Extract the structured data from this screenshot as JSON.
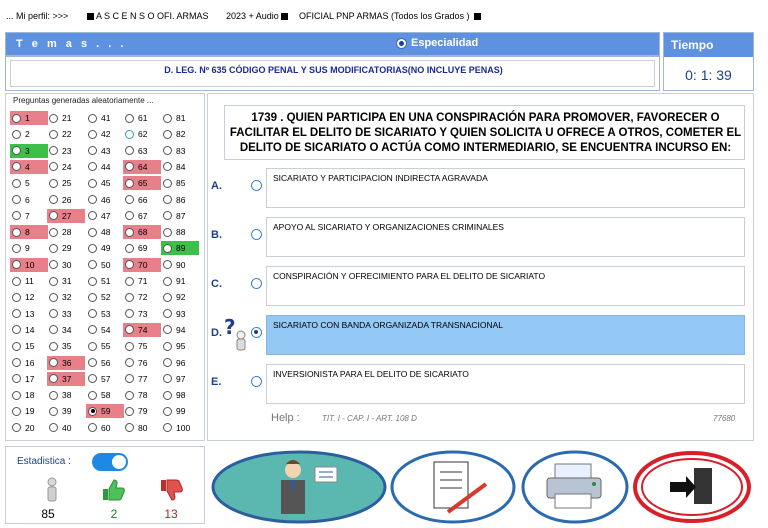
{
  "topbar": {
    "perfil": "... Mi perfil:  >>>",
    "censo": "A S C E N S O  OFI. ARMAS",
    "year": "2023  +  Audio",
    "oficial": "OFICIAL  PNP  ARMAS  (Todos los Grados )"
  },
  "header": {
    "temas": "T e m a s . . .",
    "especialidad": "Especialidad",
    "tema_text": "D. LEG. Nº 635 CÓDIGO PENAL Y SUS MODIFICATORIAS(NO INCLUYE PENAS)"
  },
  "tiempo": {
    "title": "Tiempo",
    "value": "0: 1: 39"
  },
  "grid": {
    "title": "Preguntas generadas aleatoriamente ...",
    "columns": [
      [
        "1",
        "2",
        "3",
        "4",
        "5",
        "6",
        "7",
        "8",
        "9",
        "10",
        "11",
        "12",
        "13",
        "14",
        "15",
        "16",
        "17",
        "18",
        "19",
        "20"
      ],
      [
        "21",
        "22",
        "23",
        "24",
        "25",
        "26",
        "27",
        "28",
        "29",
        "30",
        "31",
        "32",
        "33",
        "34",
        "35",
        "36",
        "37",
        "38",
        "39",
        "40"
      ],
      [
        "41",
        "42",
        "43",
        "44",
        "45",
        "46",
        "47",
        "48",
        "49",
        "50",
        "51",
        "52",
        "53",
        "54",
        "55",
        "56",
        "57",
        "58",
        "59",
        "60"
      ],
      [
        "61",
        "62",
        "63",
        "64",
        "65",
        "66",
        "67",
        "68",
        "69",
        "70",
        "71",
        "72",
        "73",
        "74",
        "75",
        "76",
        "77",
        "78",
        "79",
        "80"
      ],
      [
        "81",
        "82",
        "83",
        "84",
        "85",
        "86",
        "87",
        "88",
        "89",
        "90",
        "91",
        "92",
        "93",
        "94",
        "95",
        "96",
        "97",
        "98",
        "99",
        "100"
      ]
    ],
    "red": [
      "1",
      "4",
      "8",
      "10",
      "27",
      "36",
      "37",
      "59",
      "64",
      "65",
      "68",
      "70",
      "74"
    ],
    "green": [
      "3",
      "89"
    ],
    "cyan": [
      "62"
    ],
    "selected": [
      "59"
    ]
  },
  "question": {
    "text": "1739 . QUIEN PARTICIPA EN UNA CONSPIRACIÓN PARA PROMOVER, FAVORECER O FACILITAR EL DELITO DE SICARIATO Y QUIEN SOLICITA U OFRECE A OTROS, COMETER EL DELITO DE SICARIATO O ACTÚA COMO INTERMEDIARIO, SE ENCUENTRA INCURSO EN:",
    "options": [
      {
        "letter": "A.",
        "text": "SICARIATO Y PARTICIPACION INDIRECTA AGRAVADA"
      },
      {
        "letter": "B.",
        "text": "APOYO AL SICARIATO Y ORGANIZACIONES CRIMINALES"
      },
      {
        "letter": "C.",
        "text": "CONSPIRACIÓN Y OFRECIMIENTO PARA EL DELITO DE SICARIATO"
      },
      {
        "letter": "D.",
        "text": "SICARIATO CON BANDA ORGANIZADA TRANSNACIONAL"
      },
      {
        "letter": "E.",
        "text": "INVERSIONISTA PARA EL DELITO DE SICARIATO"
      }
    ],
    "selected_index": 3,
    "help_label": "Help :",
    "help_ref": "TIT. I - CAP. I - ART. 108 D",
    "code": "77680"
  },
  "stats": {
    "label": "Estadistica :",
    "total": "85",
    "correct": "2",
    "wrong": "13"
  },
  "colors": {
    "header_blue": "#5e92e0",
    "wrong_red": "#e8808a",
    "right_green": "#3cc04a",
    "selected_option": "#94c8f5"
  }
}
